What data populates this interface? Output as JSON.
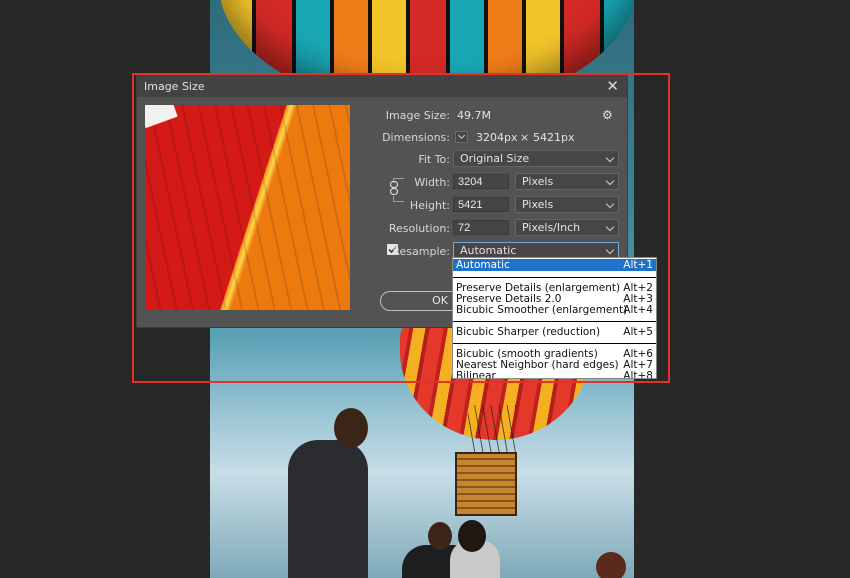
{
  "dialog": {
    "title": "Image Size",
    "close_glyph": "✕",
    "gear_glyph": "⚙",
    "image_size_label": "Image Size:",
    "image_size_value": "49.7M",
    "dimensions_label": "Dimensions:",
    "dimensions_width": "3204",
    "dimensions_width_unit": "px",
    "dimensions_times": "×",
    "dimensions_height": "5421",
    "dimensions_height_unit": "px",
    "fit_to_label": "Fit To:",
    "fit_to_value": "Original Size",
    "width_label": "Width:",
    "width_value": "3204",
    "width_unit": "Pixels",
    "height_label": "Height:",
    "height_value": "5421",
    "height_unit": "Pixels",
    "resolution_label": "Resolution:",
    "resolution_value": "72",
    "resolution_unit": "Pixels/Inch",
    "resample_label": "Resample:",
    "resample_checked": true,
    "resample_value": "Automatic",
    "ok_label": "OK"
  },
  "resample_menu": {
    "selected_index": 0,
    "groups": [
      [
        {
          "label": "Automatic",
          "shortcut": "Alt+1"
        }
      ],
      [
        {
          "label": "Preserve Details (enlargement)",
          "shortcut": "Alt+2"
        },
        {
          "label": "Preserve Details 2.0",
          "shortcut": "Alt+3"
        },
        {
          "label": "Bicubic Smoother (enlargement)",
          "shortcut": "Alt+4"
        }
      ],
      [
        {
          "label": "Bicubic Sharper (reduction)",
          "shortcut": "Alt+5"
        }
      ],
      [
        {
          "label": "Bicubic (smooth gradients)",
          "shortcut": "Alt+6"
        },
        {
          "label": "Nearest Neighbor (hard edges)",
          "shortcut": "Alt+7"
        },
        {
          "label": "Bilinear",
          "shortcut": "Alt+8"
        }
      ]
    ]
  },
  "colors": {
    "highlight": "#e0332a",
    "dialog_bg": "#535353",
    "selection": "#1e72c9"
  },
  "icons": [
    "close-icon",
    "gear-icon",
    "chevron-down-icon",
    "link-chain-icon",
    "checkmark-icon"
  ]
}
